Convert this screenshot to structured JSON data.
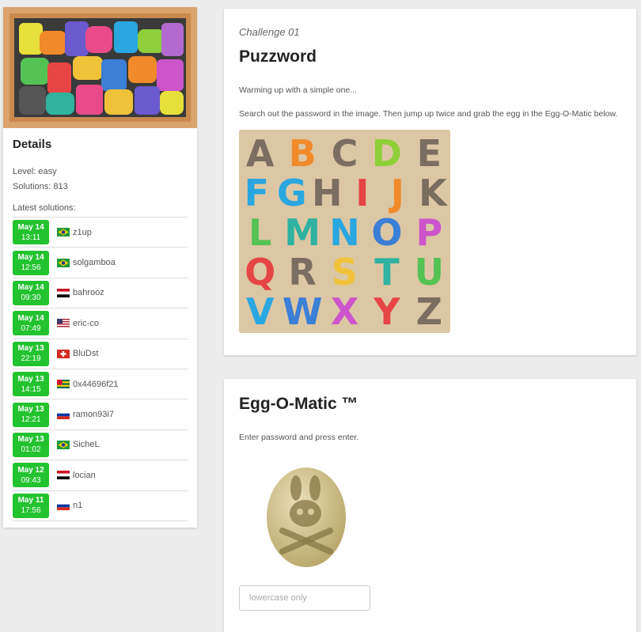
{
  "sidebar": {
    "details_heading": "Details",
    "level": "Level: easy",
    "solutions": "Solutions: 813",
    "latest_label": "Latest solutions:",
    "entries": [
      {
        "date": "May 14",
        "time": "13:11",
        "flag": "flag-brazil",
        "name": "z1up"
      },
      {
        "date": "May 14",
        "time": "12:56",
        "flag": "flag-brazil",
        "name": "solgamboa"
      },
      {
        "date": "May 14",
        "time": "09:30",
        "flag": "flag-egypt",
        "name": "bahrooz"
      },
      {
        "date": "May 14",
        "time": "07:49",
        "flag": "flag-usa",
        "name": "eric-co"
      },
      {
        "date": "May 13",
        "time": "22:19",
        "flag": "flag-switzerland",
        "name": "BluDst"
      },
      {
        "date": "May 13",
        "time": "14:15",
        "flag": "flag-togo",
        "name": "0x44696f21"
      },
      {
        "date": "May 13",
        "time": "12:21",
        "flag": "flag-russia",
        "name": "ramon93i7"
      },
      {
        "date": "May 13",
        "time": "01:02",
        "flag": "flag-brazil",
        "name": "SicheL"
      },
      {
        "date": "May 12",
        "time": "09:43",
        "flag": "flag-egypt",
        "name": "locian"
      },
      {
        "date": "May 11",
        "time": "17:56",
        "flag": "flag-russia",
        "name": "n1"
      }
    ]
  },
  "challenge": {
    "kicker": "Challenge 01",
    "title": "Puzzword",
    "intro": "Warming up with a simple one...",
    "instructions": "Search out the password in the image. Then jump up twice and grab the egg in the Egg-O-Matic below.",
    "puzzle_letters": [
      "A",
      "B",
      "C",
      "D",
      "E",
      "F",
      "G",
      "H",
      "I",
      "J",
      "K",
      "L",
      "M",
      "N",
      "O",
      "P",
      "Q",
      "R",
      "S",
      "T",
      "U",
      "V",
      "W",
      "X",
      "Y",
      "Z"
    ]
  },
  "eggomatic": {
    "title": "Egg-O-Matic ™",
    "instruction": "Enter password and press enter.",
    "input_placeholder": "lowercase only",
    "input_value": ""
  },
  "colors": {
    "badge_green": "#22c32e",
    "card_bg": "#ffffff",
    "page_bg": "#ececec"
  }
}
